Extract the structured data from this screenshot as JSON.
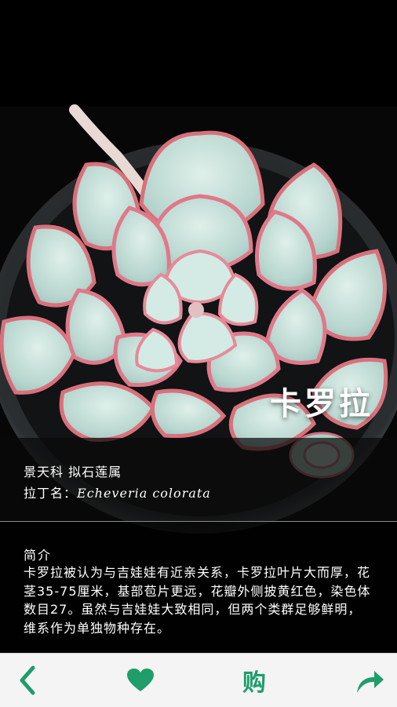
{
  "plant": {
    "name": "卡罗拉",
    "family_genus": "景天科 拟石莲属",
    "latin_prefix": "拉丁名：",
    "latin_name": "Echeveria colorata"
  },
  "description": {
    "title": "简介",
    "body": "卡罗拉被认为与吉娃娃有近亲关系，卡罗拉叶片大而厚，花茎35-75厘米，基部苞片更远，花瓣外侧披黄红色，染色体数目27。虽然与吉娃娃大致相同，但两个类群足够鲜明，维系作为单独物种存在。"
  },
  "toolbar": {
    "buy_label": "购",
    "icons": [
      "chevron-left-icon",
      "heart-icon",
      "share-arrow-icon"
    ],
    "accent_color": "#1f9d6a"
  },
  "colors": {
    "background": "#000000",
    "toolbar_bg": "#f4f4f4"
  }
}
